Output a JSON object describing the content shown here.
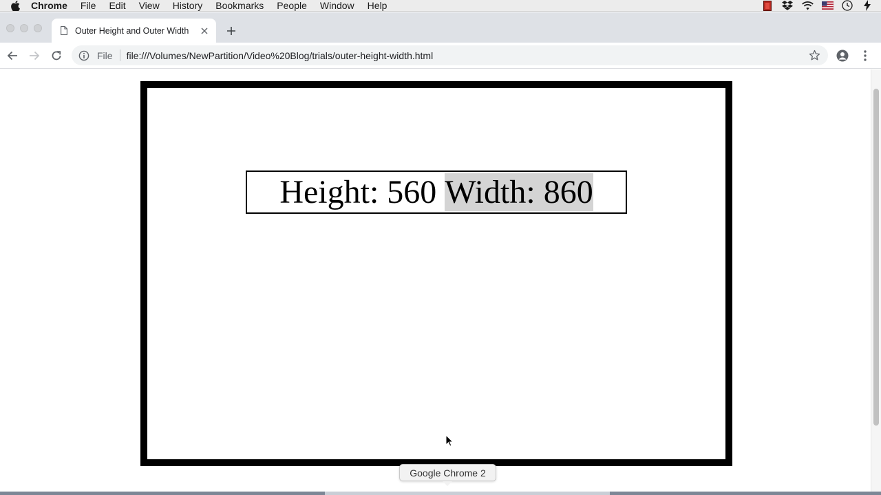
{
  "menubar": {
    "app_name": "Chrome",
    "items": [
      "File",
      "Edit",
      "View",
      "History",
      "Bookmarks",
      "People",
      "Window",
      "Help"
    ],
    "status_icons": [
      "screen-record-icon",
      "dropbox-icon",
      "wifi-icon",
      "us-flag-input-icon",
      "clock-icon",
      "battery-icon"
    ]
  },
  "browser": {
    "tab": {
      "title": "Outer Height and Outer Width",
      "icon": "document-icon"
    },
    "address": {
      "scheme_label": "File",
      "url": "file:///Volumes/NewPartition/Video%20Blog/trials/outer-height-width.html"
    }
  },
  "page": {
    "height_label": "Height: 560",
    "width_label": "Width: 860"
  },
  "dock": {
    "tooltip": "Google Chrome 2"
  },
  "colors": {
    "tab_strip": "#dee1e6",
    "omnibox": "#f1f3f4",
    "outer_border": "#000000",
    "selection": "#d4d4d4"
  }
}
